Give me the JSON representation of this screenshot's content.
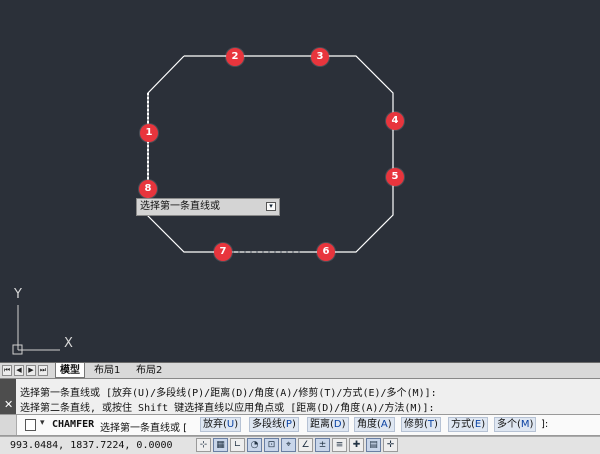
{
  "canvas": {
    "markers": [
      "1",
      "2",
      "3",
      "4",
      "5",
      "6",
      "7",
      "8"
    ],
    "tooltip": {
      "text": "选择第一条直线或",
      "button_icon": "arrow-down-icon"
    },
    "ucs": {
      "x_label": "X",
      "y_label": "Y"
    },
    "colors": {
      "background": "#2b3039",
      "lines": "#ffffff",
      "marker": "#e8353d"
    }
  },
  "tabs": {
    "nav_icons": [
      "first-icon",
      "prev-icon",
      "next-icon",
      "last-icon"
    ],
    "items": [
      "模型",
      "布局1",
      "布局2"
    ],
    "active": "模型"
  },
  "command_history": {
    "line1": "选择第一条直线或 [放弃(U)/多段线(P)/距离(D)/角度(A)/修剪(T)/方式(E)/多个(M)]:",
    "line2": "选择第二条直线, 或按住 Shift 键选择直线以应用角点或 [距离(D)/角度(A)/方法(M)]:",
    "close_icon": "close-icon"
  },
  "command_line": {
    "command": "CHAMFER",
    "prompt": "选择第一条直线或 [",
    "options": [
      {
        "label": "放弃",
        "key": "U"
      },
      {
        "label": "多段线",
        "key": "P"
      },
      {
        "label": "距离",
        "key": "D"
      },
      {
        "label": "角度",
        "key": "A"
      },
      {
        "label": "修剪",
        "key": "T"
      },
      {
        "label": "方式",
        "key": "E"
      },
      {
        "label": "多个",
        "key": "M"
      }
    ],
    "tail": "]:"
  },
  "status": {
    "coordinates": "993.0484,  1837.7224, 0.0000",
    "buttons": [
      "snap-icon",
      "grid-icon",
      "ortho-icon",
      "polar-icon",
      "osnap-icon",
      "otrack-icon",
      "ducs-icon",
      "dyn-icon",
      "lweight-icon",
      "tpy-icon",
      "qp-icon",
      "sc-icon"
    ]
  }
}
